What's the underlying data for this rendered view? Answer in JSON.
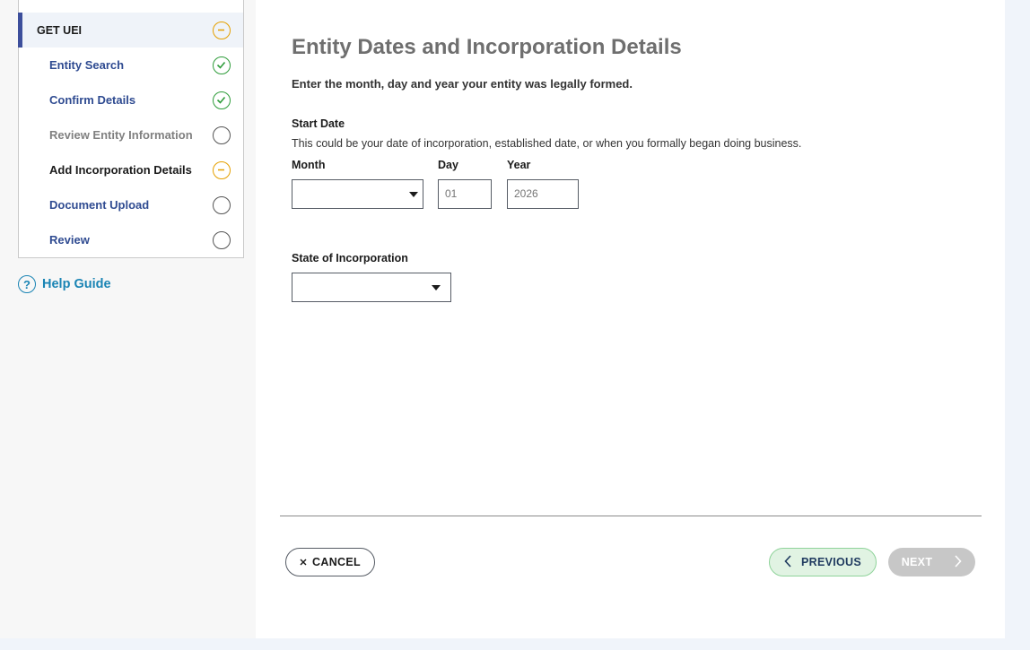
{
  "sidebar": {
    "section_title": "GET UEI",
    "steps": [
      {
        "label": "Entity Search",
        "status": "complete",
        "icon": "check-circle-icon"
      },
      {
        "label": "Confirm Details",
        "status": "complete",
        "icon": "check-circle-icon"
      },
      {
        "label": "Review Entity Information",
        "status": "not-started",
        "icon": "empty-circle-icon"
      },
      {
        "label": "Add Incorporation Details",
        "status": "in-progress",
        "icon": "minus-circle-icon"
      },
      {
        "label": "Document Upload",
        "status": "not-started",
        "icon": "empty-circle-icon"
      },
      {
        "label": "Review",
        "status": "not-started",
        "icon": "empty-circle-icon"
      }
    ],
    "help": {
      "icon_glyph": "?",
      "label": "Help Guide"
    }
  },
  "main": {
    "title": "Entity Dates and Incorporation Details",
    "intro": "Enter the month, day and year your entity was legally formed.",
    "start_date": {
      "label": "Start Date",
      "hint": "This could be your date of incorporation, established date, or when you formally began doing business.",
      "month_label": "Month",
      "month_value": "",
      "day_label": "Day",
      "day_placeholder": "01",
      "year_label": "Year",
      "year_placeholder": "2026"
    },
    "state": {
      "label": "State of Incorporation",
      "value": ""
    }
  },
  "footer": {
    "cancel_label": "CANCEL",
    "previous_label": "PREVIOUS",
    "next_label": "NEXT"
  },
  "colors": {
    "complete": "#2e9c3a",
    "in_progress": "#e5a000",
    "link": "#2f4b91",
    "help": "#1a84b4",
    "accent_bar": "#3d4f9c"
  }
}
